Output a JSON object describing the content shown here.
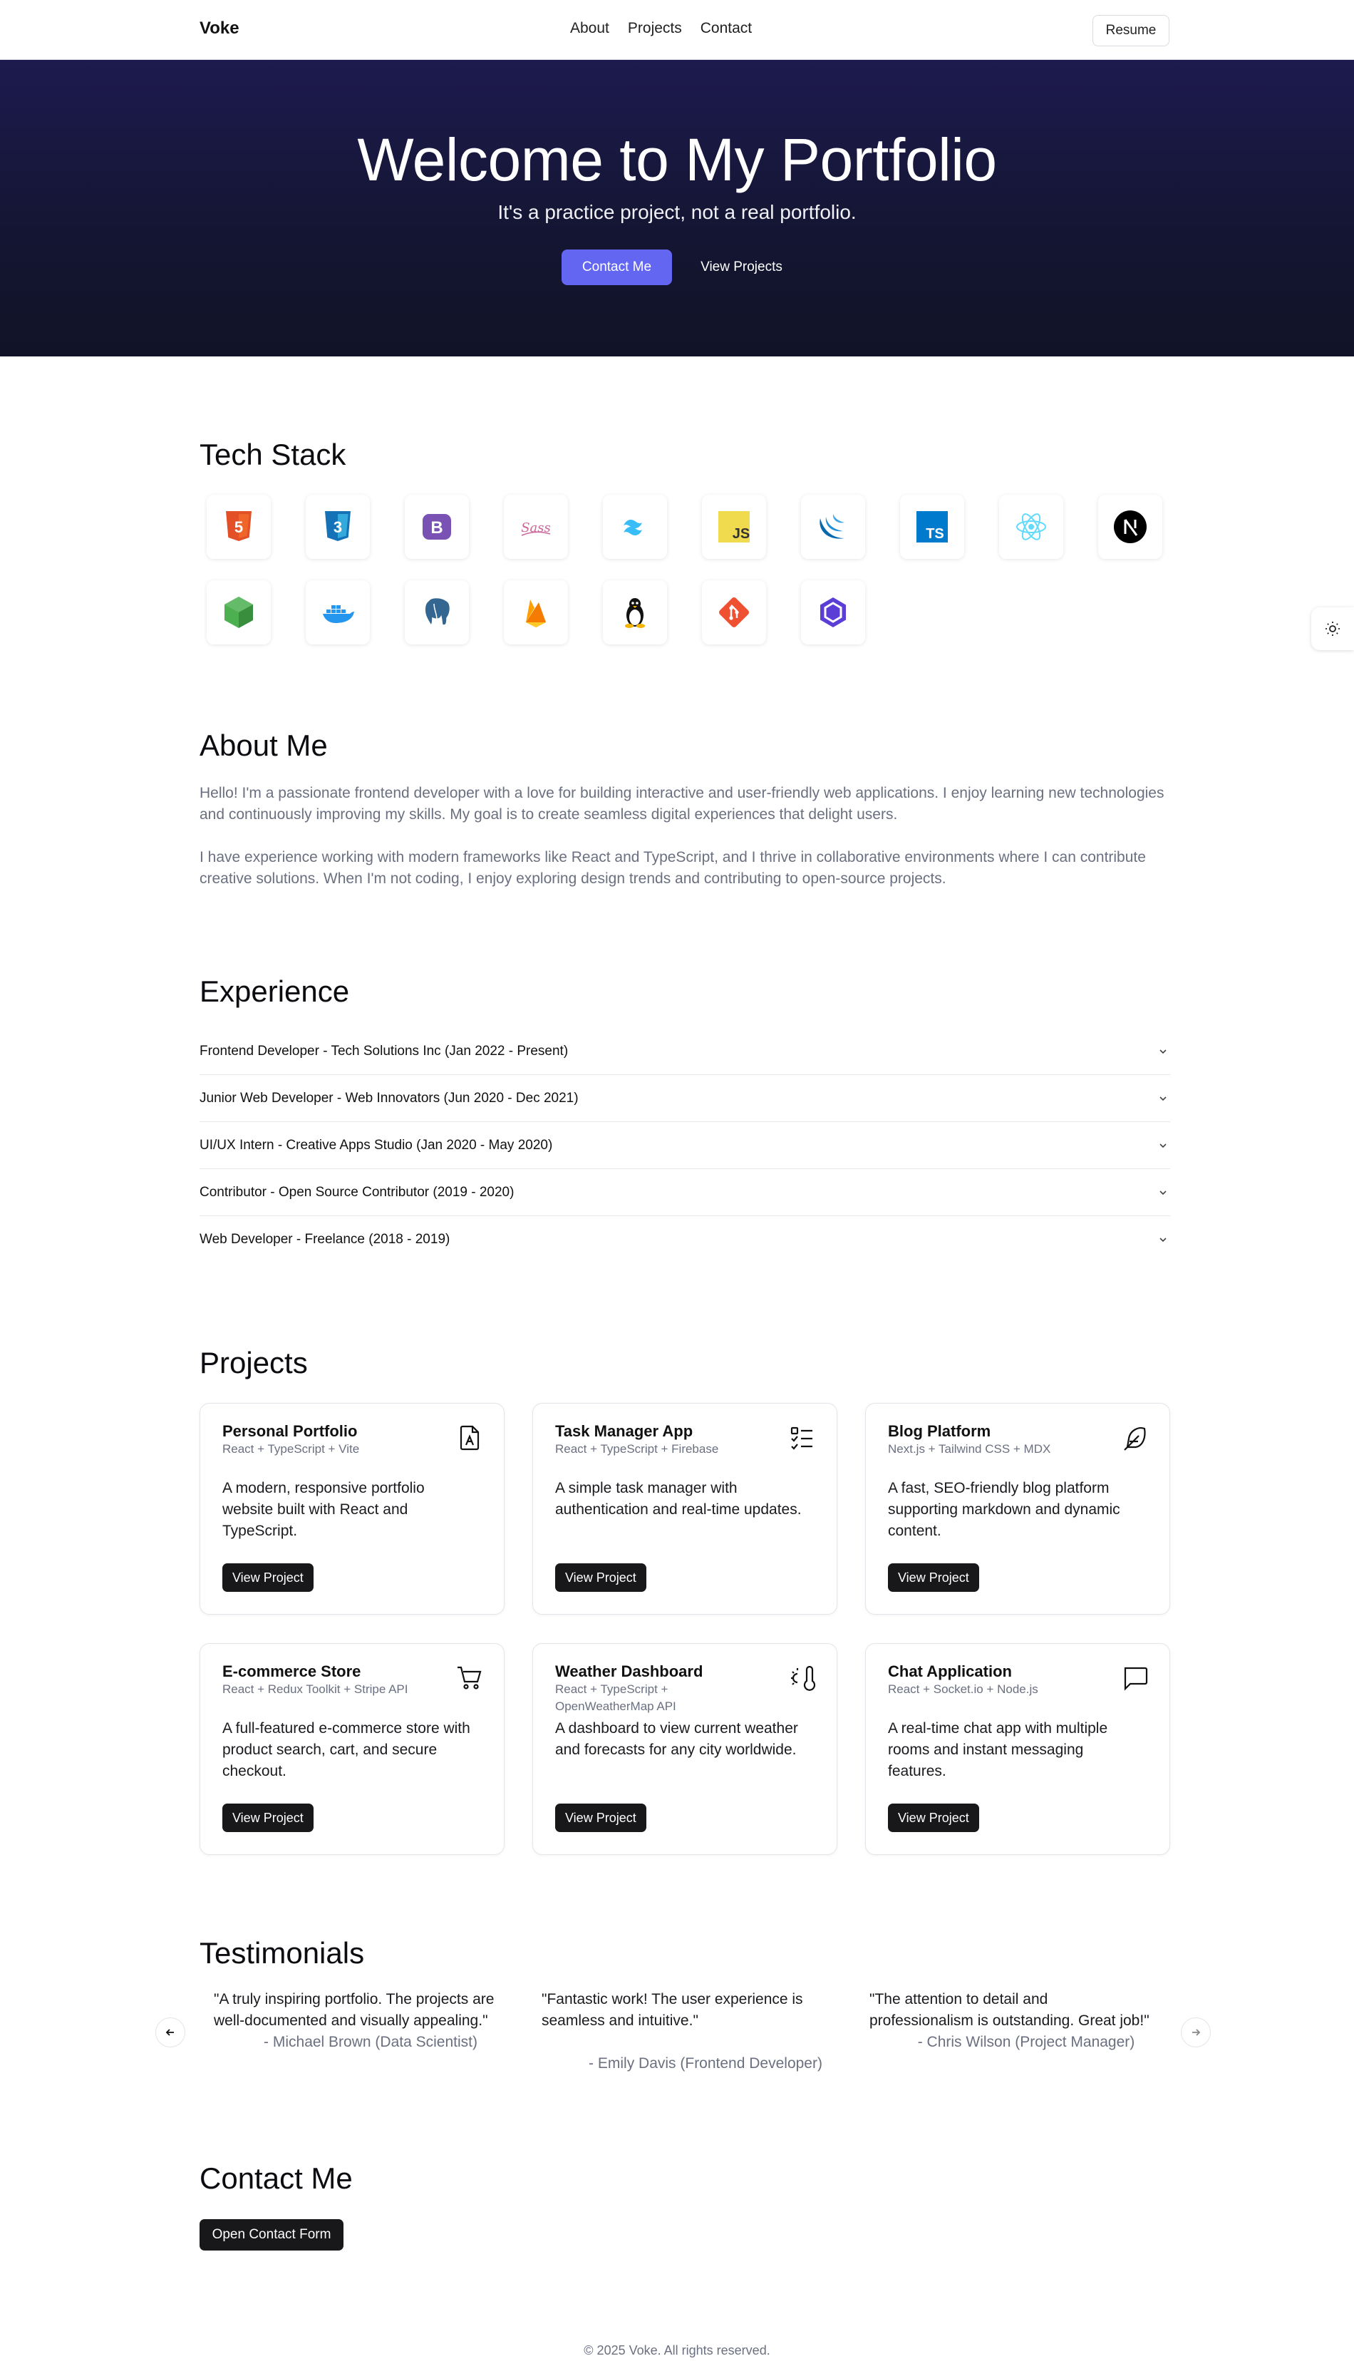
{
  "header": {
    "brand": "Voke",
    "nav": [
      "About",
      "Projects",
      "Contact"
    ],
    "resume_label": "Resume"
  },
  "hero": {
    "title": "Welcome to My Portfolio",
    "subtitle": "It's a practice project, not a real portfolio.",
    "primary_label": "Contact Me",
    "secondary_label": "View Projects"
  },
  "tech_stack": {
    "title": "Tech Stack",
    "items": [
      {
        "name": "html5-icon",
        "glyph": "5",
        "color": "#e34f26"
      },
      {
        "name": "css3-icon",
        "glyph": "3",
        "color": "#1572b6"
      },
      {
        "name": "bootstrap-icon",
        "glyph": "B",
        "color": "#7952b3"
      },
      {
        "name": "sass-icon",
        "glyph": "Sass",
        "color": "#cc6699"
      },
      {
        "name": "tailwind-icon",
        "glyph": "",
        "color": "#38bdf8"
      },
      {
        "name": "javascript-icon",
        "glyph": "JS",
        "color": "#f0db4f"
      },
      {
        "name": "jquery-icon",
        "glyph": "",
        "color": "#0769ad"
      },
      {
        "name": "typescript-icon",
        "glyph": "TS",
        "color": "#007acc"
      },
      {
        "name": "react-icon",
        "glyph": "",
        "color": "#61dafb"
      },
      {
        "name": "nextjs-icon",
        "glyph": "N",
        "color": "#000000"
      },
      {
        "name": "nodejs-icon",
        "glyph": "",
        "color": "#4caf50"
      },
      {
        "name": "docker-icon",
        "glyph": "",
        "color": "#2496ed"
      },
      {
        "name": "postgresql-icon",
        "glyph": "",
        "color": "#336791"
      },
      {
        "name": "firebase-icon",
        "glyph": "",
        "color": "#ffa000"
      },
      {
        "name": "linux-icon",
        "glyph": "",
        "color": "#000000"
      },
      {
        "name": "git-icon",
        "glyph": "",
        "color": "#f05032"
      },
      {
        "name": "graphql-icon",
        "glyph": "",
        "color": "#5b3ed6"
      }
    ]
  },
  "about": {
    "title": "About Me",
    "paragraphs": [
      "Hello! I'm a passionate frontend developer with a love for building interactive and user-friendly web applications. I enjoy learning new technologies and continuously improving my skills. My goal is to create seamless digital experiences that delight users.",
      "I have experience working with modern frameworks like React and TypeScript, and I thrive in collaborative environments where I can contribute creative solutions. When I'm not coding, I enjoy exploring design trends and contributing to open-source projects."
    ]
  },
  "experience": {
    "title": "Experience",
    "items": [
      "Frontend Developer - Tech Solutions Inc (Jan 2022 - Present)",
      "Junior Web Developer - Web Innovators (Jun 2020 - Dec 2021)",
      "UI/UX Intern - Creative Apps Studio (Jan 2020 - May 2020)",
      "Contributor - Open Source Contributor (2019 - 2020)",
      "Web Developer - Freelance (2018 - 2019)"
    ]
  },
  "projects": {
    "title": "Projects",
    "button_label": "View Project",
    "items": [
      {
        "title": "Personal Portfolio",
        "stack": "React + TypeScript + Vite",
        "desc": "A modern, responsive portfolio website built with React and TypeScript.",
        "icon": "portfolio-icon"
      },
      {
        "title": "Task Manager App",
        "stack": "React + TypeScript + Firebase",
        "desc": "A simple task manager with authentication and real-time updates.",
        "icon": "task-list-icon"
      },
      {
        "title": "Blog Platform",
        "stack": "Next.js + Tailwind CSS + MDX",
        "desc": "A fast, SEO-friendly blog platform supporting markdown and dynamic content.",
        "icon": "feather-icon"
      },
      {
        "title": "E-commerce Store",
        "stack": "React + Redux Toolkit + Stripe API",
        "desc": "A full-featured e-commerce store with product search, cart, and secure checkout.",
        "icon": "cart-icon"
      },
      {
        "title": "Weather Dashboard",
        "stack": "React + TypeScript + OpenWeatherMap API",
        "desc": "A dashboard to view current weather and forecasts for any city worldwide.",
        "icon": "thermometer-sun-icon"
      },
      {
        "title": "Chat Application",
        "stack": "React + Socket.io + Node.js",
        "desc": "A real-time chat app with multiple rooms and instant messaging features.",
        "icon": "chat-icon"
      }
    ]
  },
  "testimonials": {
    "title": "Testimonials",
    "items": [
      {
        "quote": "\"A truly inspiring portfolio. The projects are well-documented and visually appealing.\"",
        "author": "- Michael Brown (Data Scientist)"
      },
      {
        "quote": "\"Fantastic work! The user experience is seamless and intuitive.\"",
        "author": "- Emily Davis (Frontend Developer)"
      },
      {
        "quote": "\"The attention to detail and professionalism is outstanding. Great job!\"",
        "author": "- Chris Wilson (Project Manager)"
      }
    ]
  },
  "contact": {
    "title": "Contact Me",
    "button_label": "Open Contact Form"
  },
  "footer": {
    "text": "© 2025 Voke. All rights reserved."
  },
  "colors": {
    "accent": "#6366f1",
    "hero_bg": "#1d1a4e",
    "button_dark": "#18181b",
    "muted_text": "#6b7080"
  }
}
